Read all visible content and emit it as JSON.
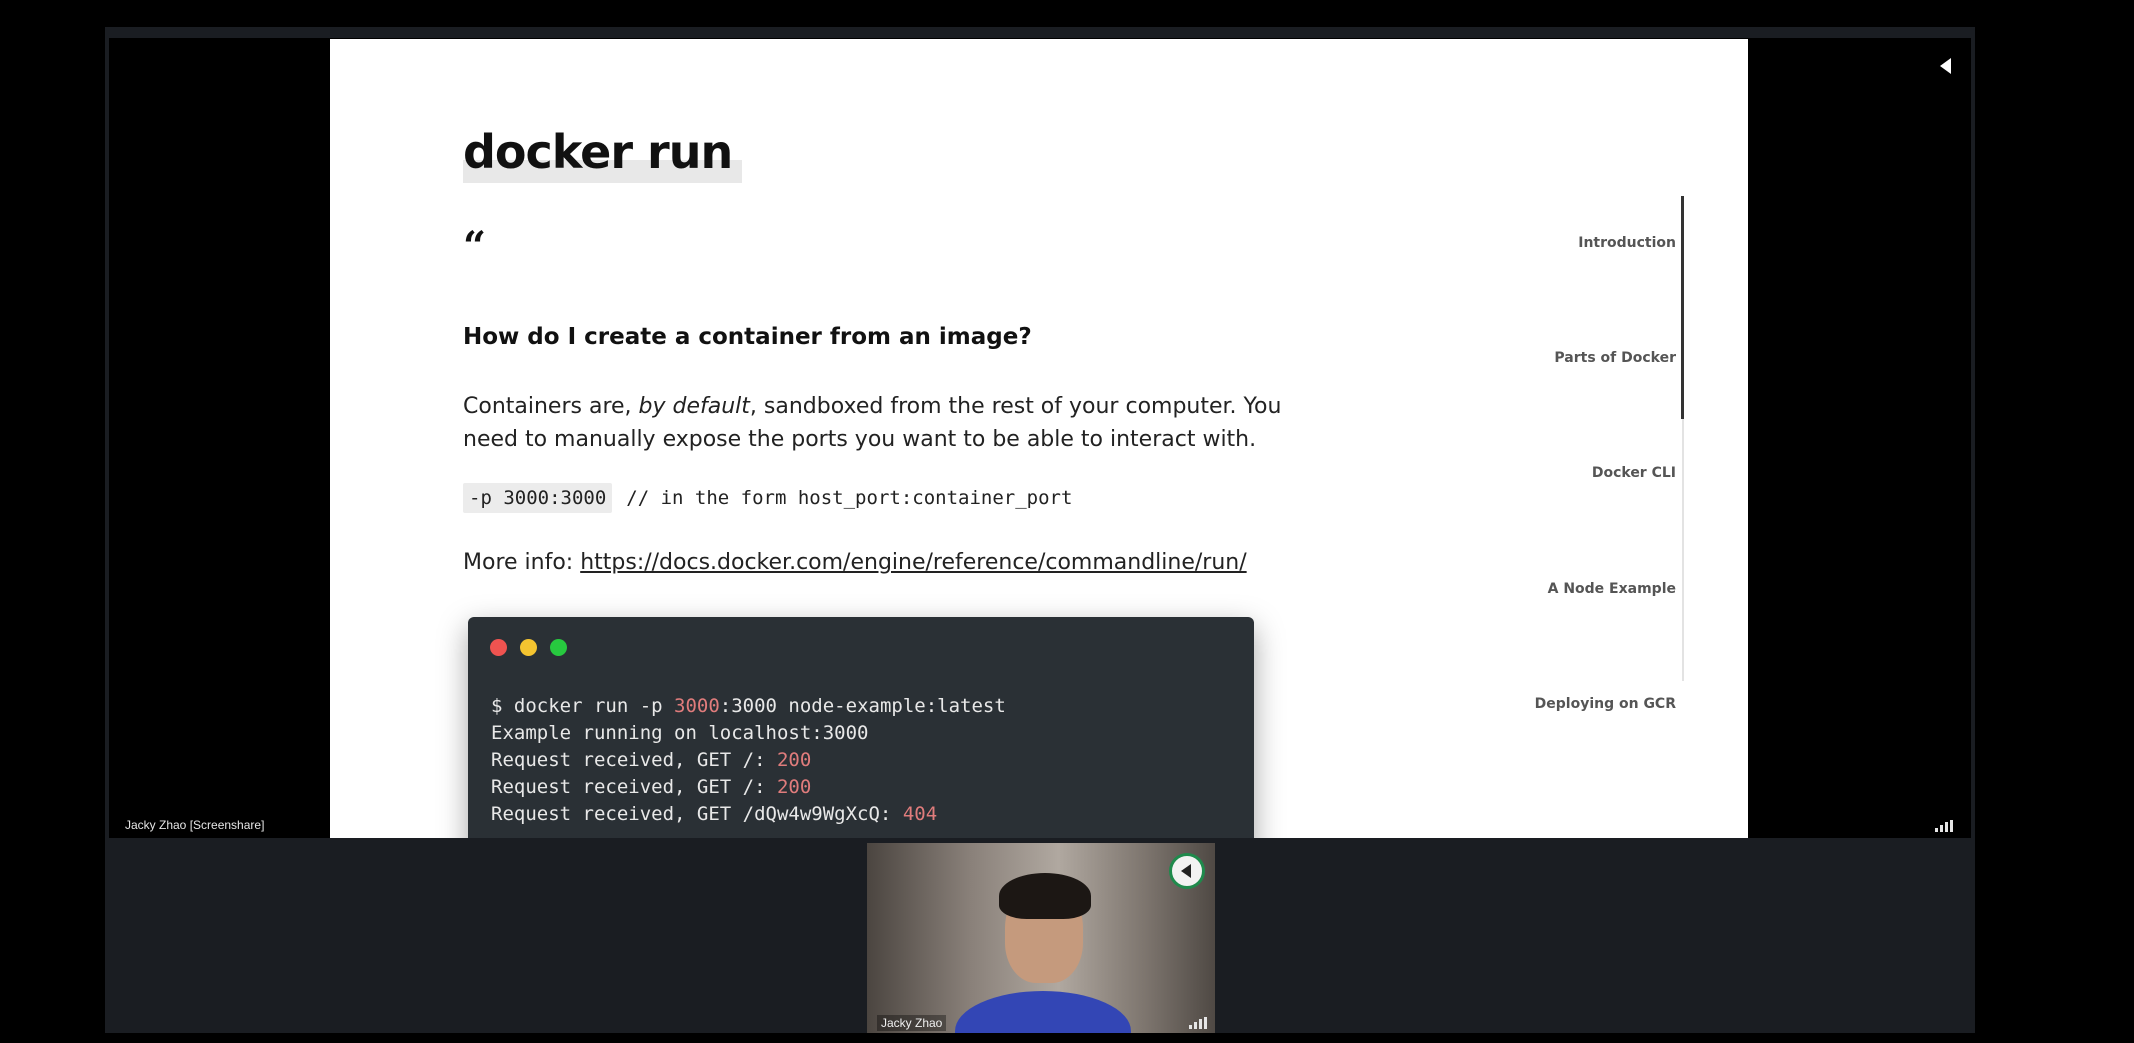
{
  "screenshare": {
    "label": "Jacky Zhao [Screenshare]"
  },
  "slide": {
    "title": "docker run",
    "quote_mark": "“",
    "question": "How do I create a container from an image?",
    "paragraph_before": "Containers are, ",
    "paragraph_emphasis": "by default",
    "paragraph_after": ", sandboxed from the rest of your computer. You need to manually expose the ports you want to be able to interact with.",
    "code_flag": "-p 3000:3000",
    "code_comment": "// in the form host_port:container_port",
    "more_info_label": "More info: ",
    "more_info_link": "https://docs.docker.com/engine/reference/commandline/run/"
  },
  "terminal": {
    "dot_colors": [
      "#ef5350",
      "#f4c430",
      "#27c93f"
    ],
    "highlight_color": "#e07c7c",
    "line1_a": "$ docker run -p ",
    "line1_b": "3000",
    "line1_c": ":3000 node-example:latest",
    "line2": "Example running on localhost:3000",
    "line3_a": "Request received, GET /: ",
    "line3_b": "200",
    "line4_a": "Request received, GET /: ",
    "line4_b": "200",
    "line5_a": "Request received, GET /dQw4w9WgXcQ: ",
    "line5_b": "404"
  },
  "toc": {
    "items": [
      {
        "label": "Introduction"
      },
      {
        "label": "Parts of Docker"
      },
      {
        "label": "Docker CLI"
      },
      {
        "label": "A Node Example"
      },
      {
        "label": "Deploying on GCR"
      }
    ],
    "progress_fraction": 0.46
  },
  "participant": {
    "name": "Jacky Zhao",
    "pin_color": "#1f8a4c"
  }
}
